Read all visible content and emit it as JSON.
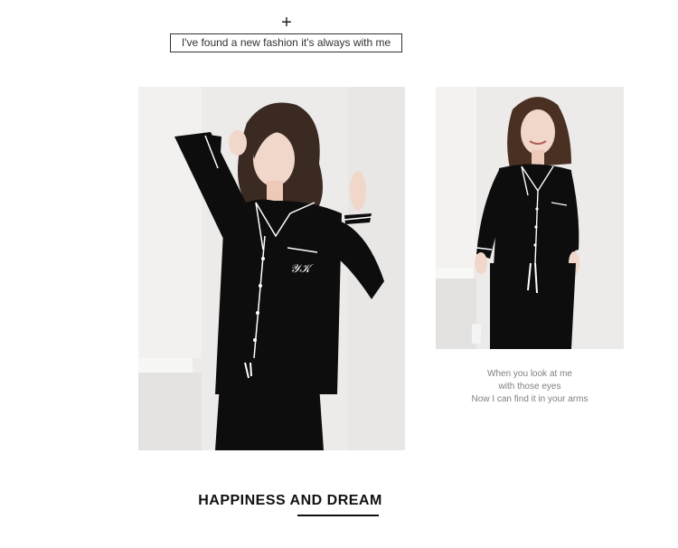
{
  "header": {
    "plus_symbol": "+",
    "tagline": "I've found a new fashion it's always with me"
  },
  "photos": [
    {
      "subject": "woman-in-black-pajamas-standing"
    },
    {
      "subject": "woman-in-black-pajamas-smiling"
    }
  ],
  "poem": {
    "lines": [
      "When you look at me",
      "with those eyes",
      "Now I can find it in your arms"
    ]
  },
  "section": {
    "heading": "HAPPINESS AND DREAM"
  },
  "colors": {
    "background": "#ffffff",
    "photo_wall": "#ecebe9",
    "garment": "#0d0d0d",
    "piping": "#ffffff",
    "poem_text": "#7f7f7f",
    "heading_text": "#111111"
  }
}
